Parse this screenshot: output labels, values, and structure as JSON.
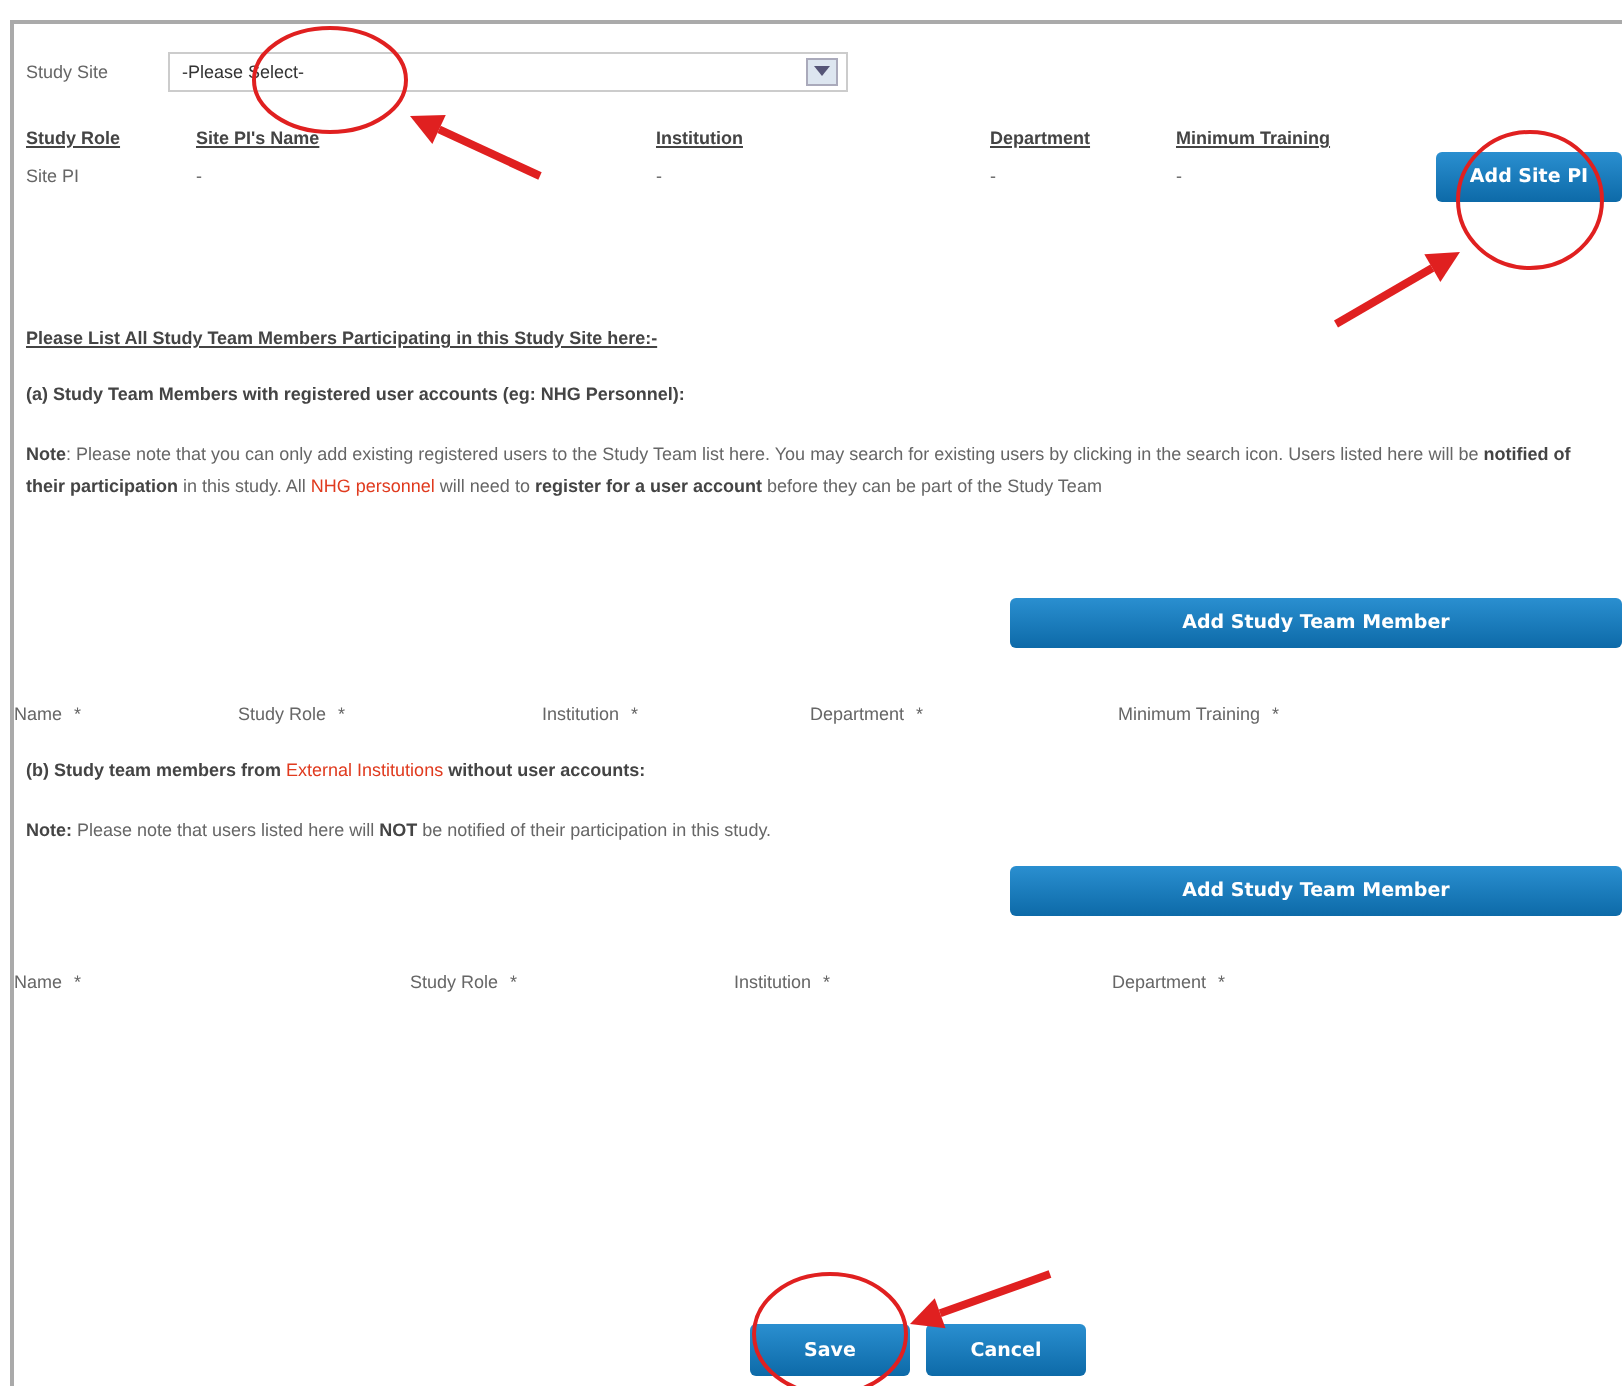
{
  "study_site": {
    "label": "Study Site",
    "placeholder": "-Please Select-"
  },
  "site_pi_table": {
    "columns": [
      "Study Role",
      "Site PI's Name",
      "Institution",
      "Department",
      "Minimum Training"
    ],
    "rows": [
      [
        "Site PI",
        "-",
        "-",
        "-",
        "-"
      ]
    ]
  },
  "add_site_pi_button": "Add Site PI",
  "list_heading": "Please List All Study Team Members Participating in this Study Site here:-",
  "sections": [
    {
      "heading": [
        {
          "kind": "bold",
          "text": "(a) Study Team Members with registered user accounts (eg: NHG Personnel):"
        }
      ],
      "note": [
        {
          "kind": "bold",
          "text": "Note"
        },
        {
          "kind": "plain",
          "text": ": Please note that you can only add existing registered users to the Study Team list here. You may search for existing users by clicking in the search icon. Users listed here will be "
        },
        {
          "kind": "bold",
          "text": "notified of their participation"
        },
        {
          "kind": "plain",
          "text": " in this study. All "
        },
        {
          "kind": "red",
          "text": "NHG personnel"
        },
        {
          "kind": "plain",
          "text": " will need to "
        },
        {
          "kind": "bold",
          "text": "register for a user account"
        },
        {
          "kind": "plain",
          "text": " before they can be part of the Study Team"
        }
      ],
      "button": "Add Study Team Member",
      "fields": [
        {
          "label": "Name",
          "marker": "*"
        },
        {
          "label": "Study Role",
          "marker": "*"
        },
        {
          "label": "Institution",
          "marker": "*"
        },
        {
          "label": "Department",
          "marker": "*"
        },
        {
          "label": "Minimum Training",
          "marker": "*"
        }
      ]
    },
    {
      "heading": [
        {
          "kind": "bold",
          "text": "(b) Study team members from "
        },
        {
          "kind": "red",
          "text": "External Institutions"
        },
        {
          "kind": "bold",
          "text": " without user accounts:"
        }
      ],
      "note": [
        {
          "kind": "bold",
          "text": "Note:"
        },
        {
          "kind": "plain",
          "text": " Please note that users listed here will "
        },
        {
          "kind": "bold",
          "text": "NOT"
        },
        {
          "kind": "plain",
          "text": " be notified of their participation in this study."
        }
      ],
      "button": "Add Study Team Member",
      "fields": [
        {
          "label": "Name",
          "marker": "*"
        },
        {
          "label": "Study Role",
          "marker": "*"
        },
        {
          "label": "Institution",
          "marker": "*"
        },
        {
          "label": "Department",
          "marker": "*"
        }
      ]
    }
  ],
  "actions": [
    "Save",
    "Cancel"
  ]
}
